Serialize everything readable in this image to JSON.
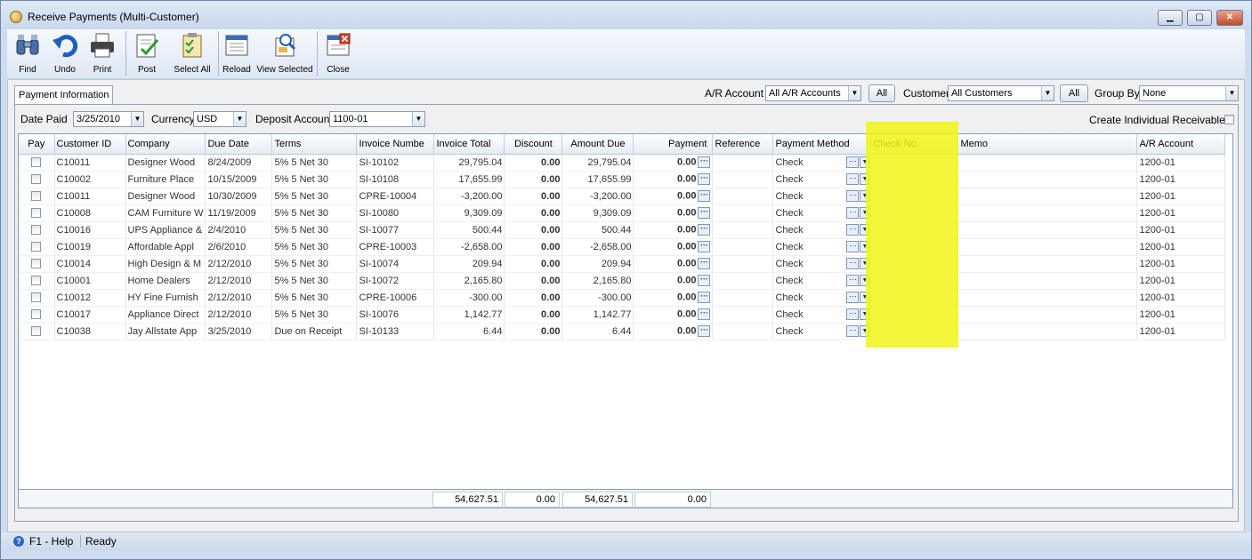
{
  "window": {
    "title": "Receive Payments (Multi-Customer)"
  },
  "toolbar": {
    "find": "Find",
    "undo": "Undo",
    "print": "Print",
    "post": "Post",
    "select_all": "Select All",
    "reload": "Reload",
    "view_selected": "View Selected",
    "close": "Close"
  },
  "tabs": {
    "payment_information": "Payment Information"
  },
  "filters": {
    "ar_account_label": "A/R Account",
    "ar_account_value": "All A/R Accounts",
    "all_btn_1": "All",
    "customer_label": "Customer",
    "customer_value": "All Customers",
    "all_btn_2": "All",
    "group_by_label": "Group By",
    "group_by_value": "None"
  },
  "form": {
    "date_paid_label": "Date Paid",
    "date_paid_value": "3/25/2010",
    "currency_label": "Currency",
    "currency_value": "USD",
    "deposit_account_label": "Deposit Account",
    "deposit_account_value": "1100-01",
    "create_individual_label": "Create Individual Receivables"
  },
  "grid": {
    "columns": [
      "Pay",
      "Customer ID",
      "Company",
      "Due Date",
      "Terms",
      "Invoice Numbe",
      "Invoice Total",
      "Discount",
      "Amount Due",
      "Payment",
      "Reference",
      "Payment Method",
      "Check No.",
      "Memo",
      "A/R Account"
    ],
    "rows": [
      {
        "customer_id": "C10011",
        "company": "Designer Wood",
        "due_date": "8/24/2009",
        "terms": "5% 5 Net 30",
        "invoice": "SI-10102",
        "total": "29,795.04",
        "discount": "0.00",
        "amount_due": "29,795.04",
        "payment": "0.00",
        "reference": "",
        "method": "Check",
        "check_no": "",
        "memo": "",
        "ar_account": "1200-01"
      },
      {
        "customer_id": "C10002",
        "company": "Furniture Place",
        "due_date": "10/15/2009",
        "terms": "5% 5 Net 30",
        "invoice": "SI-10108",
        "total": "17,655.99",
        "discount": "0.00",
        "amount_due": "17,655.99",
        "payment": "0.00",
        "reference": "",
        "method": "Check",
        "check_no": "",
        "memo": "",
        "ar_account": "1200-01"
      },
      {
        "customer_id": "C10011",
        "company": "Designer Wood",
        "due_date": "10/30/2009",
        "terms": "5% 5 Net 30",
        "invoice": "CPRE-10004",
        "total": "-3,200.00",
        "discount": "0.00",
        "amount_due": "-3,200.00",
        "payment": "0.00",
        "reference": "",
        "method": "Check",
        "check_no": "",
        "memo": "",
        "ar_account": "1200-01"
      },
      {
        "customer_id": "C10008",
        "company": "CAM Furniture W",
        "due_date": "11/19/2009",
        "terms": "5% 5 Net 30",
        "invoice": "SI-10080",
        "total": "9,309.09",
        "discount": "0.00",
        "amount_due": "9,309.09",
        "payment": "0.00",
        "reference": "",
        "method": "Check",
        "check_no": "",
        "memo": "",
        "ar_account": "1200-01"
      },
      {
        "customer_id": "C10016",
        "company": "UPS Appliance &",
        "due_date": "2/4/2010",
        "terms": "5% 5 Net 30",
        "invoice": "SI-10077",
        "total": "500.44",
        "discount": "0.00",
        "amount_due": "500.44",
        "payment": "0.00",
        "reference": "",
        "method": "Check",
        "check_no": "",
        "memo": "",
        "ar_account": "1200-01"
      },
      {
        "customer_id": "C10019",
        "company": "Affordable Appl",
        "due_date": "2/6/2010",
        "terms": "5% 5 Net 30",
        "invoice": "CPRE-10003",
        "total": "-2,658.00",
        "discount": "0.00",
        "amount_due": "-2,658.00",
        "payment": "0.00",
        "reference": "",
        "method": "Check",
        "check_no": "",
        "memo": "",
        "ar_account": "1200-01"
      },
      {
        "customer_id": "C10014",
        "company": "High Design & M",
        "due_date": "2/12/2010",
        "terms": "5% 5 Net 30",
        "invoice": "SI-10074",
        "total": "209.94",
        "discount": "0.00",
        "amount_due": "209.94",
        "payment": "0.00",
        "reference": "",
        "method": "Check",
        "check_no": "",
        "memo": "",
        "ar_account": "1200-01"
      },
      {
        "customer_id": "C10001",
        "company": "Home Dealers",
        "due_date": "2/12/2010",
        "terms": "5% 5 Net 30",
        "invoice": "SI-10072",
        "total": "2,165.80",
        "discount": "0.00",
        "amount_due": "2,165.80",
        "payment": "0.00",
        "reference": "",
        "method": "Check",
        "check_no": "",
        "memo": "",
        "ar_account": "1200-01"
      },
      {
        "customer_id": "C10012",
        "company": "HY Fine Furnish",
        "due_date": "2/12/2010",
        "terms": "5% 5 Net 30",
        "invoice": "CPRE-10006",
        "total": "-300.00",
        "discount": "0.00",
        "amount_due": "-300.00",
        "payment": "0.00",
        "reference": "",
        "method": "Check",
        "check_no": "",
        "memo": "",
        "ar_account": "1200-01"
      },
      {
        "customer_id": "C10017",
        "company": "Appliance Direct",
        "due_date": "2/12/2010",
        "terms": "5% 5 Net 30",
        "invoice": "SI-10076",
        "total": "1,142.77",
        "discount": "0.00",
        "amount_due": "1,142.77",
        "payment": "0.00",
        "reference": "",
        "method": "Check",
        "check_no": "",
        "memo": "",
        "ar_account": "1200-01"
      },
      {
        "customer_id": "C10038",
        "company": "Jay Allstate App",
        "due_date": "3/25/2010",
        "terms": "Due on Receipt",
        "invoice": "SI-10133",
        "total": "6.44",
        "discount": "0.00",
        "amount_due": "6.44",
        "payment": "0.00",
        "reference": "",
        "method": "Check",
        "check_no": "",
        "memo": "",
        "ar_account": "1200-01"
      }
    ],
    "totals": {
      "invoice_total": "54,627.51",
      "discount": "0.00",
      "amount_due": "54,627.51",
      "payment": "0.00"
    }
  },
  "status": {
    "help": "F1 - Help",
    "state": "Ready"
  },
  "colors": {
    "highlight": "#f0f514",
    "header_bg": "#e6ebf3",
    "window_bg": "#cfdced"
  },
  "icons": [
    "binoculars-icon",
    "undo-icon",
    "printer-icon",
    "post-icon",
    "select-all-icon",
    "reload-icon",
    "view-selected-icon",
    "close-icon",
    "help-icon"
  ]
}
